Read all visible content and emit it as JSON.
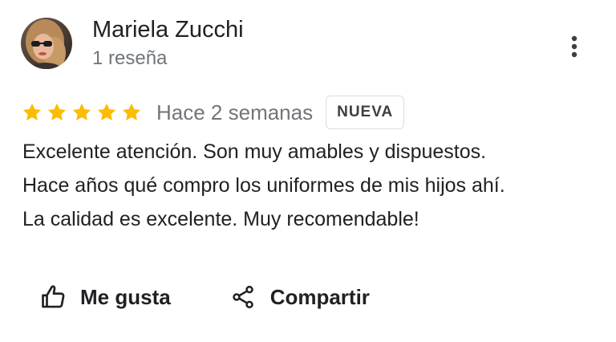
{
  "reviewer": {
    "name": "Mariela Zucchi",
    "review_count": "1 reseña",
    "avatar_icon": "profile-photo"
  },
  "menu": {
    "icon": "more-vert-icon"
  },
  "rating": {
    "stars": 5,
    "max_stars": 5,
    "star_color": "#fbbc04",
    "date": "Hace 2 semanas",
    "badge": "NUEVA"
  },
  "review": {
    "lines": [
      "Excelente atención. Son muy amables y dispuestos.",
      "Hace años qué compro los uniformes de mis hijos ahí.",
      "La calidad es excelente. Muy recomendable!"
    ]
  },
  "actions": {
    "like_label": "Me gusta",
    "like_icon": "thumb-up-icon",
    "share_label": "Compartir",
    "share_icon": "share-icon"
  }
}
